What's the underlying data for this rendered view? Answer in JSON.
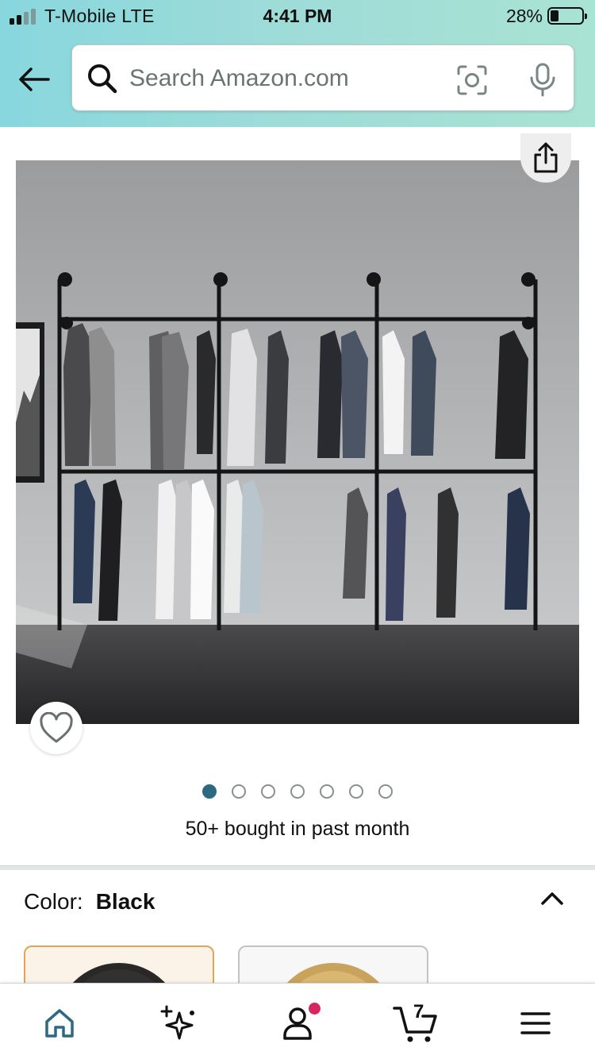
{
  "status_bar": {
    "carrier": "T-Mobile  LTE",
    "time": "4:41 PM",
    "battery_percent": "28%",
    "battery_level": 0.28,
    "signal_bars": 2
  },
  "search": {
    "placeholder": "Search Amazon.com",
    "value": ""
  },
  "product": {
    "image_count": 7,
    "active_image_index": 0,
    "bought_text": "50+ bought in past month"
  },
  "color_selector": {
    "label": "Color:",
    "selected_value": "Black",
    "options": [
      "Black",
      "Gold"
    ]
  },
  "cart": {
    "count": "7"
  },
  "icons": {
    "back": "arrow-left-icon",
    "search": "search-icon",
    "camera": "camera-scan-icon",
    "microphone": "microphone-icon",
    "share": "share-icon",
    "wishlist": "heart-icon",
    "collapse": "chevron-up-icon",
    "home": "home-icon",
    "ai": "sparkles-icon",
    "account": "person-icon",
    "cart": "cart-icon",
    "menu": "hamburger-menu-icon"
  },
  "colors": {
    "header_gradient_start": "#88d7de",
    "header_gradient_end": "#a9e3d3",
    "active_dot": "#2d6a82",
    "selected_swatch_border": "#e3a35a",
    "account_badge": "#d6285e",
    "home_icon": "#2d6a82"
  }
}
